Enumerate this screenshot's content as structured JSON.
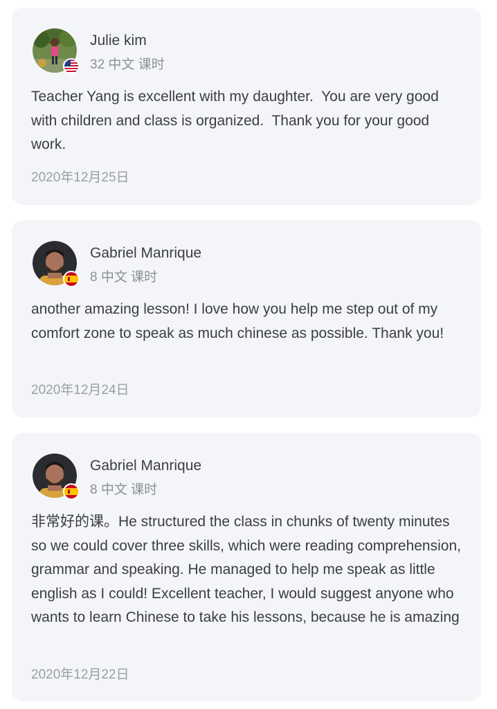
{
  "reviews": [
    {
      "name": "Julie kim",
      "lessons": "32 中文 课时",
      "text": "Teacher Yang is excellent with my daughter.  You are very good with children and class is organized.  Thank you for your good work.",
      "date": "2020年12月25日",
      "flag_icon": "us-flag-icon"
    },
    {
      "name": "Gabriel Manrique",
      "lessons": "8 中文 课时",
      "text": "another amazing lesson! I love how you help me step out of my comfort zone to speak as much chinese as possible. Thank you!",
      "date": "2020年12月24日",
      "flag_icon": "spain-flag-icon"
    },
    {
      "name": "Gabriel Manrique",
      "lessons": "8 中文 课时",
      "text": "非常好的课。He structured the class in chunks of twenty minutes so we could cover three skills, which were reading comprehension, grammar and speaking. He managed to help me speak as little english as I could! Excellent teacher, I would suggest anyone who wants to learn Chinese to take his lessons, because he is amazing",
      "date": "2020年12月22日",
      "flag_icon": "spain-flag-icon"
    }
  ],
  "colors": {
    "card_background": "#f4f5f8",
    "text": "#3b3d45",
    "muted": "#8c8f99"
  }
}
